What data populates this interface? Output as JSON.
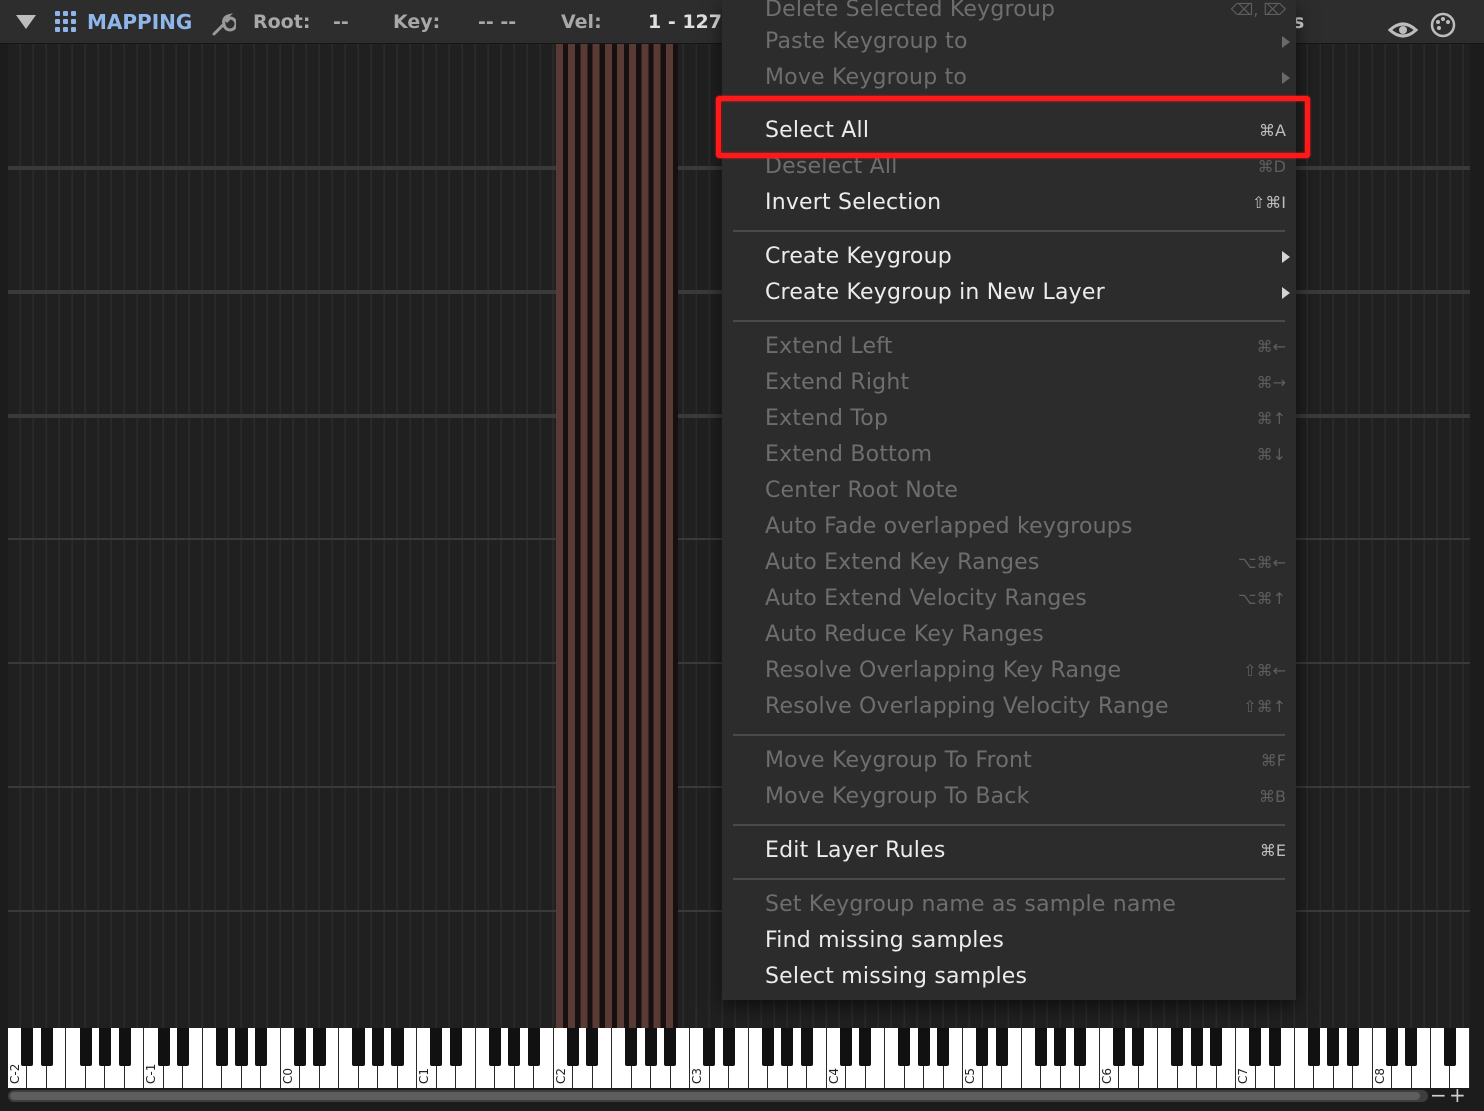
{
  "header": {
    "title": "MAPPING",
    "root_label": "Root:",
    "root_value": "--",
    "key_label": "Key:",
    "key_value": "-- --",
    "vel_label": "Vel:",
    "vel_value": "1 - 127",
    "partial_text": "s",
    "icons": [
      "collapse-triangle-icon",
      "grid-icon",
      "wrench-icon",
      "eye-icon",
      "palette-icon"
    ]
  },
  "keyboard": {
    "octave_labels": [
      "C-2",
      "C-1",
      "C0",
      "C1",
      "C2",
      "C3",
      "C4",
      "C5",
      "C6",
      "C7",
      "C8"
    ]
  },
  "colors": {
    "accent": "#8fb6ea",
    "keygroup": "#5a3a35",
    "highlight": "#ff1a1a"
  },
  "menu": {
    "items": [
      {
        "label": "Delete Selected Keygroup",
        "shortcut": "⌫, ⌦",
        "disabled": true
      },
      {
        "label": "Paste Keygroup to",
        "submenu": true,
        "disabled": true
      },
      {
        "label": "Move Keygroup to",
        "submenu": true,
        "disabled": true
      },
      {
        "label": "Select All",
        "shortcut": "⌘A",
        "disabled": false,
        "highlighted": true
      },
      {
        "label": "Deselect All",
        "shortcut": "⌘D",
        "disabled": true
      },
      {
        "label": "Invert Selection",
        "shortcut": "⇧⌘I",
        "disabled": false
      },
      {
        "label": "Create Keygroup",
        "submenu": true,
        "disabled": false
      },
      {
        "label": "Create Keygroup in New Layer",
        "submenu": true,
        "disabled": false
      },
      {
        "label": "Extend Left",
        "shortcut": "⌘←",
        "disabled": true
      },
      {
        "label": "Extend Right",
        "shortcut": "⌘→",
        "disabled": true
      },
      {
        "label": "Extend Top",
        "shortcut": "⌘↑",
        "disabled": true
      },
      {
        "label": "Extend Bottom",
        "shortcut": "⌘↓",
        "disabled": true
      },
      {
        "label": "Center Root Note",
        "disabled": true
      },
      {
        "label": "Auto Fade overlapped keygroups",
        "disabled": true
      },
      {
        "label": "Auto Extend Key Ranges",
        "shortcut": "⌥⌘←",
        "disabled": true
      },
      {
        "label": "Auto Extend Velocity Ranges",
        "shortcut": "⌥⌘↑",
        "disabled": true
      },
      {
        "label": "Auto Reduce Key Ranges",
        "disabled": true
      },
      {
        "label": "Resolve Overlapping Key Range",
        "shortcut": "⇧⌘←",
        "disabled": true
      },
      {
        "label": "Resolve Overlapping Velocity Range",
        "shortcut": "⇧⌘↑",
        "disabled": true
      },
      {
        "label": "Move Keygroup To Front",
        "shortcut": "⌘F",
        "disabled": true
      },
      {
        "label": "Move Keygroup To Back",
        "shortcut": "⌘B",
        "disabled": true
      },
      {
        "label": "Edit Layer Rules",
        "shortcut": "⌘E",
        "disabled": false
      },
      {
        "label": "Set Keygroup name as sample name",
        "disabled": true
      },
      {
        "label": "Find missing samples",
        "disabled": false
      },
      {
        "label": "Select missing samples",
        "disabled": false
      }
    ]
  }
}
